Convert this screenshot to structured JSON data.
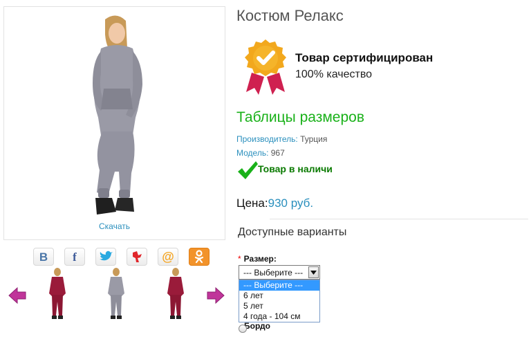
{
  "product": {
    "title": "Костюм Релакс",
    "download_label": "Скачать",
    "certificate": {
      "title": "Товар сертифицирован",
      "subtitle": "100% качество"
    },
    "size_table_link": "Таблицы размеров",
    "manufacturer": {
      "key": "Производитель:",
      "value": "Турция"
    },
    "model": {
      "key": "Модель:",
      "value": "967"
    },
    "stock_status": "Товар в наличи",
    "price": {
      "label": "Цена:",
      "value": "930 руб."
    },
    "variants_heading": "Доступные варианты"
  },
  "social": [
    {
      "icon": "vkontakte-icon",
      "color": "#4a76a8"
    },
    {
      "icon": "facebook-icon",
      "color": "#3b5998"
    },
    {
      "icon": "twitter-icon",
      "color": "#2aa9e0"
    },
    {
      "icon": "yaru-icon",
      "color": "#e0262b"
    },
    {
      "icon": "mailru-icon",
      "color": "#f5a623"
    },
    {
      "icon": "odnoklassniki-icon",
      "color": "#f2932b"
    }
  ],
  "thumbnails": [
    {
      "color": "bordeaux"
    },
    {
      "color": "grey"
    },
    {
      "color": "bordeaux"
    }
  ],
  "size_option": {
    "required_mark": "*",
    "label": "Размер:",
    "selected": "--- Выберите ---",
    "options": [
      "--- Выберите ---",
      "6 лет",
      "5 лет",
      "4 года - 104 см"
    ]
  },
  "color_option": {
    "label": "Бордо"
  },
  "colors": {
    "accent_link": "#2a8fbd",
    "size_table_green": "#19b119",
    "stock_green": "#0a7a00",
    "arrow_purple": "#c0359a",
    "medal_gold": "#f2a81d",
    "ribbon_red": "#cf2150",
    "selection_blue": "#3399ff"
  }
}
